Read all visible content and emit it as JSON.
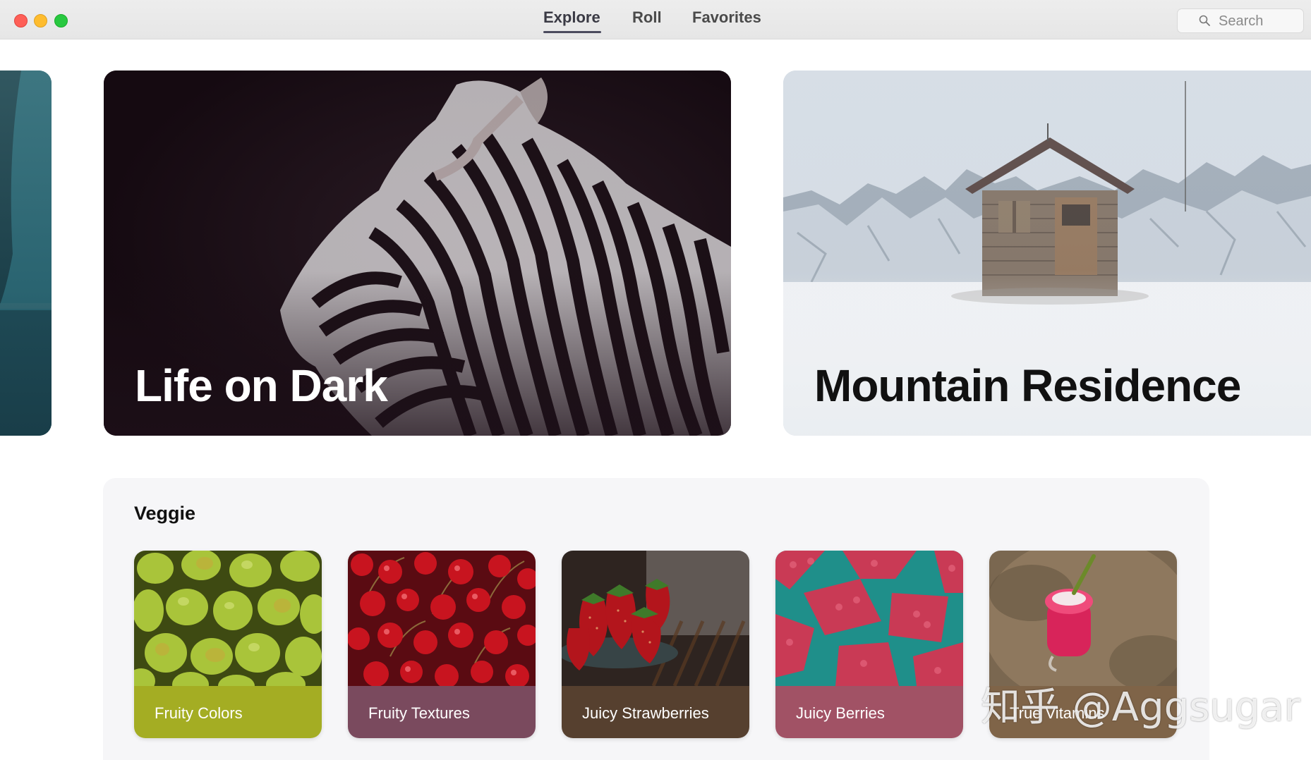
{
  "window": {
    "tabs": [
      {
        "label": "Explore",
        "active": true
      },
      {
        "label": "Roll",
        "active": false
      },
      {
        "label": "Favorites",
        "active": false
      }
    ],
    "search": {
      "placeholder": "Search"
    }
  },
  "heroes": [
    {
      "title": "",
      "image": "teal-portrait-photo"
    },
    {
      "title": "Life on Dark",
      "image": "zebra-photo"
    },
    {
      "title": "Mountain Residence",
      "image": "mountain-cabin-photo"
    }
  ],
  "section": {
    "title": "Veggie",
    "tiles": [
      {
        "label": "Fruity Colors",
        "image": "pears-photo",
        "bar_color": "#a4ad23"
      },
      {
        "label": "Fruity Textures",
        "image": "cherries-photo",
        "bar_color": "#7a4a5e"
      },
      {
        "label": "Juicy Strawberries",
        "image": "strawberries-photo",
        "bar_color": "#56402f"
      },
      {
        "label": "Juicy Berries",
        "image": "raspberries-photo",
        "bar_color": "#a15265"
      },
      {
        "label": "True Vitamins",
        "image": "smoothie-photo",
        "bar_color": "#7f6448"
      }
    ]
  },
  "watermark": "知乎 @Aggsugar",
  "colors": {
    "close": "#fe5f57",
    "minimize": "#febc2e",
    "maximize": "#28c840",
    "zebra_bg": "#1e1019"
  }
}
